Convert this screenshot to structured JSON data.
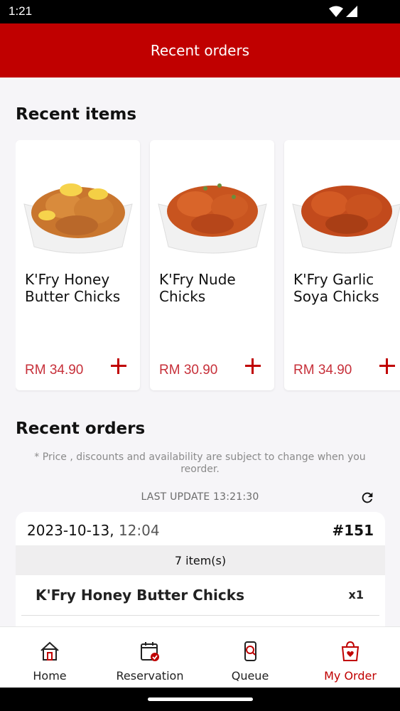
{
  "status_bar": {
    "time": "1:21"
  },
  "app_bar": {
    "title": "Recent orders"
  },
  "recent_items": {
    "title": "Recent items",
    "items": [
      {
        "name": "K'Fry Honey Butter Chicks",
        "price": "RM 34.90"
      },
      {
        "name": "K'Fry Nude Chicks",
        "price": "RM 30.90"
      },
      {
        "name": "K'Fry Garlic Soya Chicks",
        "price": "RM 34.90"
      }
    ]
  },
  "recent_orders": {
    "title": "Recent orders",
    "disclaimer": "* Price , discounts and availability are subject to change when you reorder.",
    "last_update": "LAST UPDATE 13:21:30",
    "order": {
      "date": "2023-10-13,",
      "time": "12:04",
      "number": "#151",
      "item_count": "7 item(s)",
      "lines": [
        {
          "name": "K'Fry Honey Butter Chicks",
          "qty": "x1"
        }
      ]
    }
  },
  "bottom_nav": {
    "items": [
      {
        "label": "Home",
        "icon": "home-icon"
      },
      {
        "label": "Reservation",
        "icon": "reservation-icon"
      },
      {
        "label": "Queue",
        "icon": "queue-icon"
      },
      {
        "label": "My Order",
        "icon": "my-order-icon"
      }
    ],
    "active": "My Order"
  },
  "colors": {
    "brand_red": "#c00000",
    "price_red": "#c7303a",
    "background": "#f6f5f8"
  }
}
